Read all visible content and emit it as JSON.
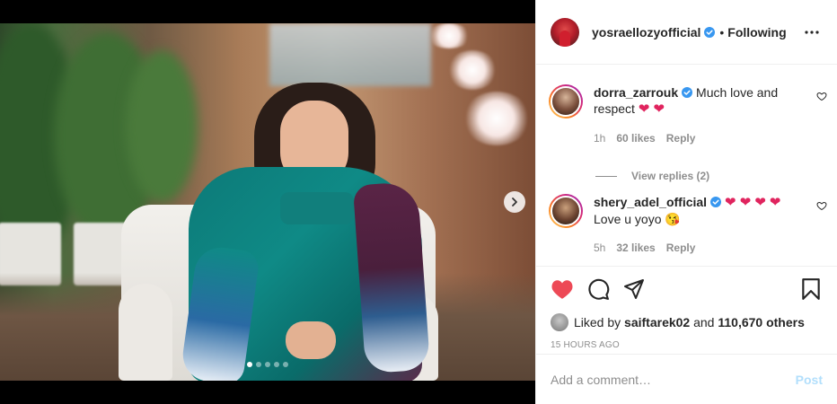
{
  "post": {
    "author": "yosraellozyofficial",
    "follow_status": "Following",
    "bullet": "•",
    "carousel": {
      "total_slides": 5,
      "active_slide": 1
    }
  },
  "comments": {
    "clipped_text": "",
    "items": [
      {
        "username": "dorra_zarrouk",
        "text": "Much love and respect",
        "emoji": "❤ ❤",
        "time": "1h",
        "likes": "60 likes",
        "reply_label": "Reply"
      },
      {
        "username": "shery_adel_official",
        "emoji_lead": "❤ ❤ ❤",
        "emoji_start": "❤",
        "text": "Love u yoyo",
        "emoji_end": "😘",
        "time": "5h",
        "likes": "32 likes",
        "reply_label": "Reply"
      }
    ],
    "view_replies": "View replies (2)"
  },
  "engagement": {
    "liked_prefix": "Liked by",
    "liked_user": "saiftarek02",
    "liked_and": "and",
    "liked_count": "110,670 others",
    "timestamp": "15 HOURS AGO"
  },
  "composer": {
    "placeholder": "Add a comment…",
    "post_label": "Post"
  },
  "colors": {
    "like_red": "#ed4956",
    "verified_blue": "#3897f0",
    "post_disabled": "#b2dffc"
  },
  "icons": [
    "chevron-right-icon",
    "verified-icon",
    "more-icon",
    "heart-icon",
    "comment-icon",
    "share-icon",
    "bookmark-icon"
  ]
}
